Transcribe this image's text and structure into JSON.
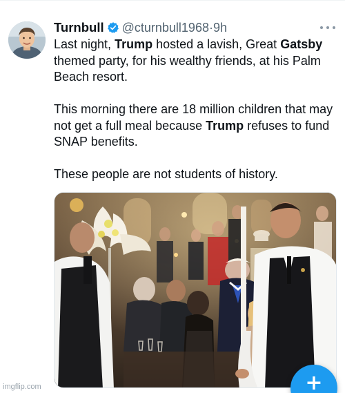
{
  "tweet": {
    "author": {
      "display_name": "Turnbull",
      "handle": "@cturnbull1968",
      "separator": "·",
      "time": "9h",
      "verified": true,
      "verified_color": "#1d9bf0"
    },
    "text": {
      "p1": {
        "t1": "Last night, ",
        "b1": "Trump",
        "t2": " hosted a lavish, Great ",
        "b2": "Gatsby",
        "t3": " themed party, for his wealthy friends, at his Palm Beach resort."
      },
      "p2": {
        "t1": "This morning there are 18 million children that may not get a full meal because ",
        "b1": "Trump",
        "t2": " refuses to fund SNAP benefits."
      },
      "p3": "These people are not students of history."
    },
    "media": {
      "type": "photo"
    }
  },
  "fab": {
    "icon": "plus-icon",
    "label": "+",
    "color": "#1d9bf0"
  },
  "more_icon": "more-icon",
  "watermark": "imgflip.com"
}
